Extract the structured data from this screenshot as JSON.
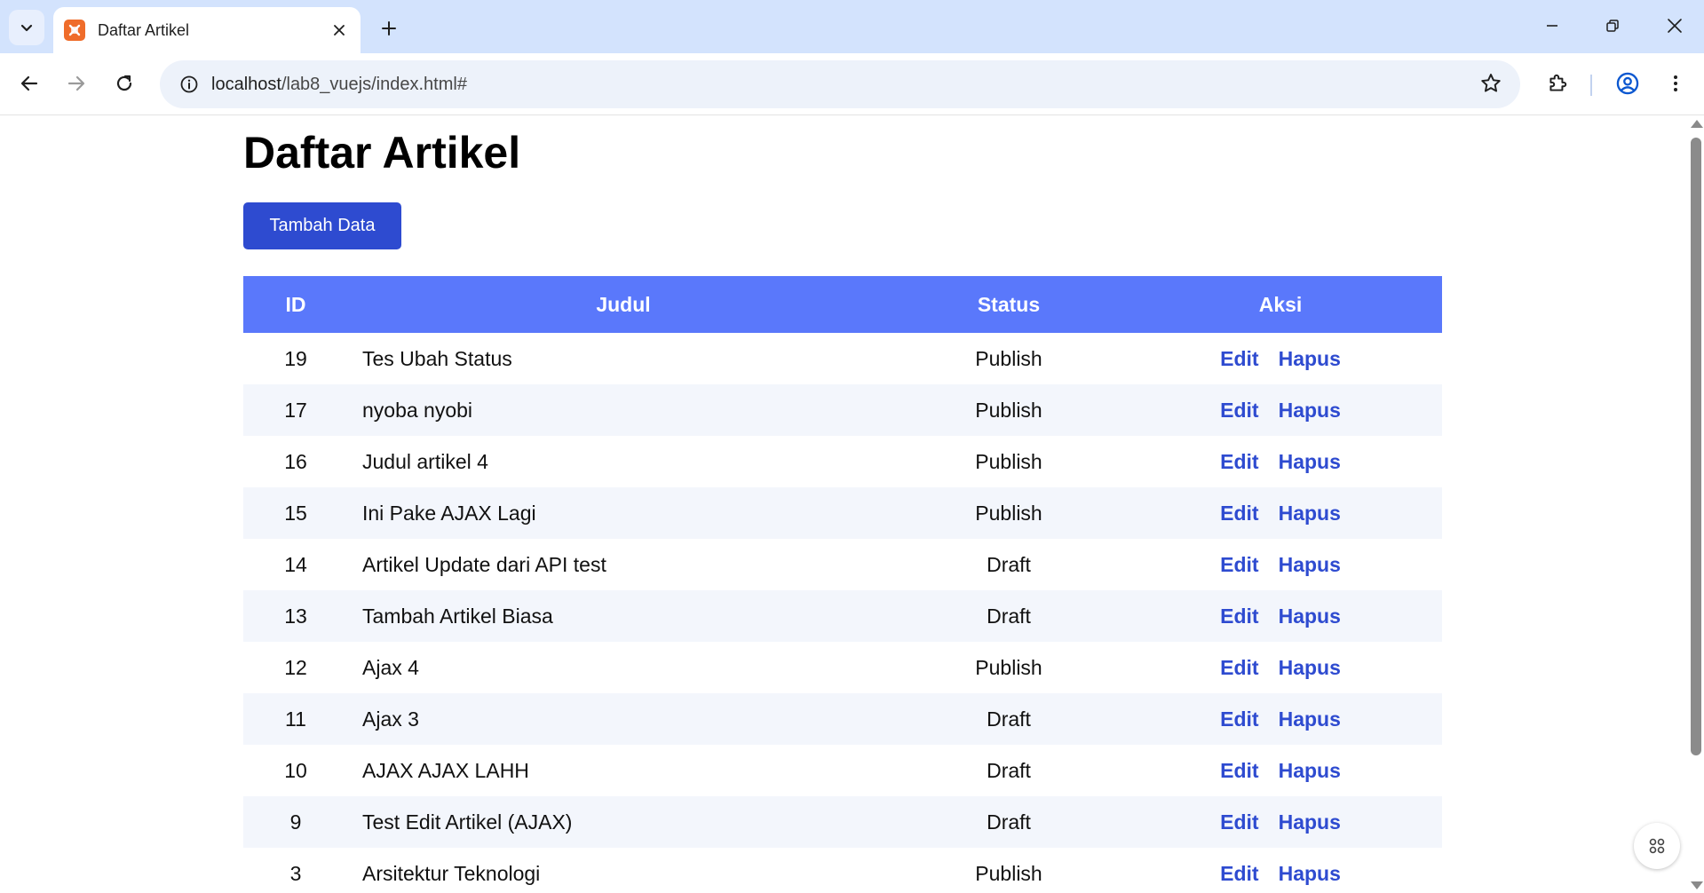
{
  "browser": {
    "tab": {
      "title": "Daftar Artikel",
      "favicon_color": "#ef6c2a"
    },
    "url": {
      "host": "localhost",
      "path": "/lab8_vuejs/index.html#"
    },
    "icons": {
      "tab_search": "chevron-down-icon",
      "tab_close": "close-icon",
      "new_tab": "plus-icon",
      "minimize": "minimize-icon",
      "restore": "restore-icon",
      "close_window": "close-icon",
      "back": "arrow-left-icon",
      "forward": "arrow-right-icon",
      "reload": "reload-icon",
      "site_info": "info-icon",
      "bookmark": "star-icon",
      "extensions": "puzzle-icon",
      "profile": "account-icon",
      "menu": "kebab-menu-icon"
    }
  },
  "page": {
    "title": "Daftar Artikel",
    "add_button": "Tambah Data",
    "accent_color": "#2e4bd0",
    "header_color": "#5a78fb",
    "table": {
      "headers": [
        "ID",
        "Judul",
        "Status",
        "Aksi"
      ],
      "rows": [
        {
          "id": "19",
          "title": "Tes Ubah Status",
          "status": "Publish"
        },
        {
          "id": "17",
          "title": "nyoba nyobi",
          "status": "Publish"
        },
        {
          "id": "16",
          "title": "Judul artikel 4",
          "status": "Publish"
        },
        {
          "id": "15",
          "title": "Ini Pake AJAX Lagi",
          "status": "Publish"
        },
        {
          "id": "14",
          "title": "Artikel Update dari API test",
          "status": "Draft"
        },
        {
          "id": "13",
          "title": "Tambah Artikel Biasa",
          "status": "Draft"
        },
        {
          "id": "12",
          "title": "Ajax 4",
          "status": "Publish"
        },
        {
          "id": "11",
          "title": "Ajax 3",
          "status": "Draft"
        },
        {
          "id": "10",
          "title": "AJAX AJAX LAHH",
          "status": "Draft"
        },
        {
          "id": "9",
          "title": "Test Edit Artikel (AJAX)",
          "status": "Draft"
        },
        {
          "id": "3",
          "title": "Arsitektur Teknologi",
          "status": "Publish"
        }
      ],
      "edit_label": "Edit",
      "delete_label": "Hapus"
    }
  }
}
